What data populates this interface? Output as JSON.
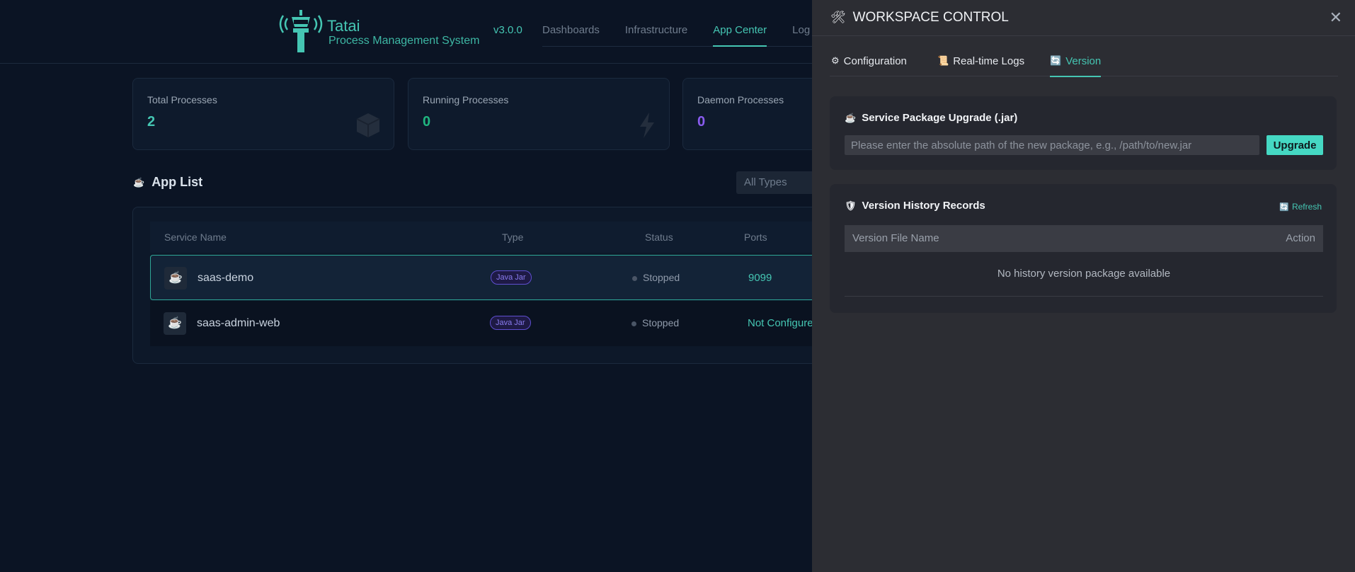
{
  "header": {
    "brand_name": "Tatai",
    "brand_sub": "Process Management System",
    "version": "v3.0.0",
    "nav": [
      "Dashboards",
      "Infrastructure",
      "App Center",
      "Log"
    ],
    "active_nav": "App Center"
  },
  "stats": [
    {
      "label": "Total Processes",
      "value": "2",
      "color": "#45c6b3",
      "icon": "box-icon"
    },
    {
      "label": "Running Processes",
      "value": "0",
      "color": "#20b680",
      "icon": "lightning-icon"
    },
    {
      "label": "Daemon Processes",
      "value": "0",
      "color": "#8a5cf0",
      "icon": "shield-icon"
    }
  ],
  "app_list": {
    "title": "App List",
    "filter_value": "All Types",
    "columns": [
      "Service Name",
      "Type",
      "Status",
      "Ports"
    ],
    "rows": [
      {
        "name": "saas-demo",
        "type": "Java Jar",
        "status": "Stopped",
        "ports": "9099",
        "selected": true
      },
      {
        "name": "saas-admin-web",
        "type": "Java Jar",
        "status": "Stopped",
        "ports": "Not Configure"
      }
    ]
  },
  "drawer": {
    "title": "WORKSPACE CONTROL",
    "tabs": [
      "Configuration",
      "Real-time Logs",
      "Version"
    ],
    "active_tab": "Version",
    "upgrade": {
      "title": "Service Package Upgrade (.jar)",
      "placeholder": "Please enter the absolute path of the new package, e.g., /path/to/new.jar",
      "button": "Upgrade"
    },
    "history": {
      "title": "Version History Records",
      "refresh": "Refresh",
      "columns": [
        "Version File Name",
        "Action"
      ],
      "empty": "No history version package available"
    }
  },
  "colors": {
    "accent": "#45c6b3",
    "drawer_bg": "#2c2d33",
    "page_bg": "#0b1424"
  }
}
